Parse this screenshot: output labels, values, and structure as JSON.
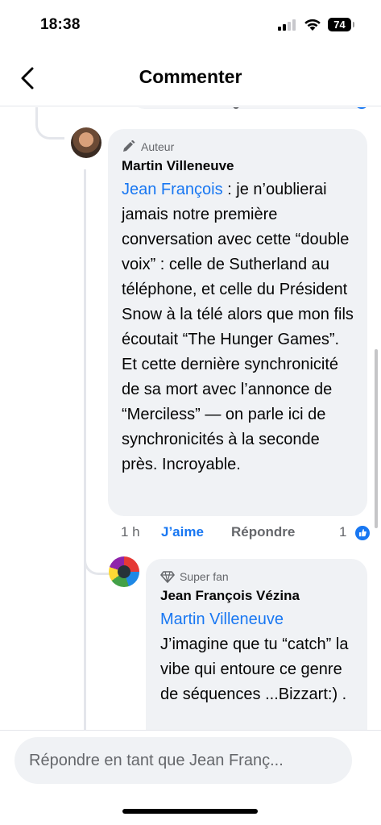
{
  "status": {
    "time": "18:38",
    "battery": "74"
  },
  "nav": {
    "title": "Commenter"
  },
  "comment1": {
    "badge": "Auteur",
    "author": "Martin Villeneuve",
    "mention": "Jean François",
    "text": " : je n’oublierai jamais notre première conversation avec cette “double voix” : celle de Sutherland au téléphone, et celle du Président Snow à la télé alors que mon fils écoutait “The Hunger Games”. Et cette dernière synchronicité de sa mort avec l’annonce de “Merciless” — on parle ici de synchronicités à la seconde près. Incroyable.",
    "time": "1 h",
    "like_label": "J’aime",
    "reply_label": "Répondre",
    "like_count": "1"
  },
  "comment2": {
    "badge": "Super fan",
    "author": "Jean François Vézina",
    "mention": "Martin Villeneuve",
    "text": "J’imagine que tu “catch” la vibe qui entoure ce genre de séquences ...Bizzart:) ."
  },
  "reply": {
    "placeholder": "Répondre en tant que Jean Franç..."
  },
  "colors": {
    "accent": "#1877f2",
    "bubble": "#f0f2f5",
    "muted": "#65676b"
  }
}
